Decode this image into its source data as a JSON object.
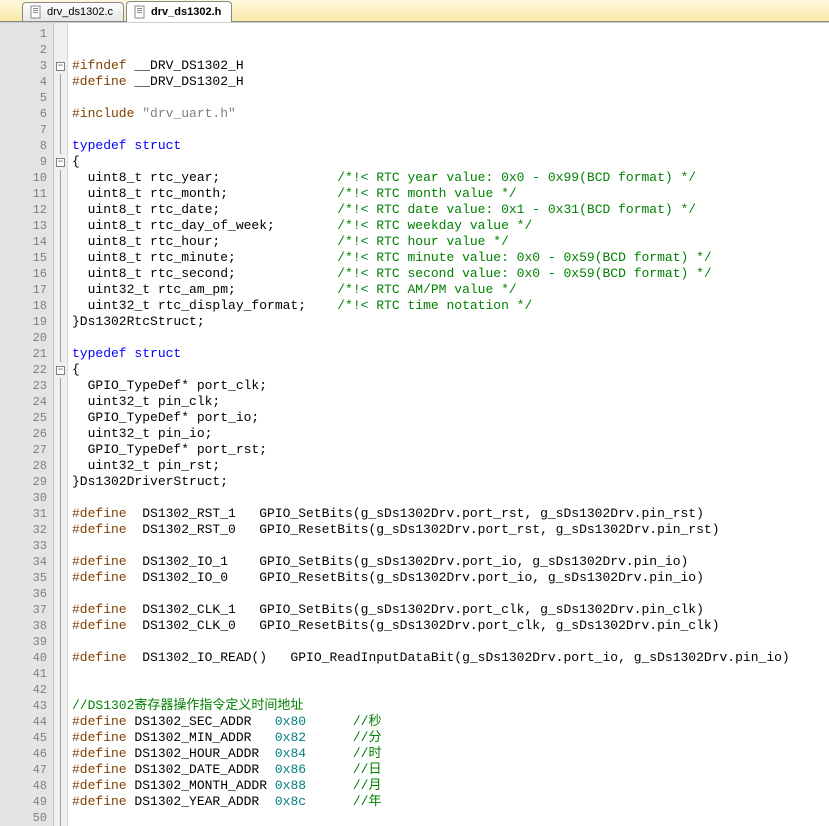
{
  "tabs": [
    {
      "label": "drv_ds1302.c",
      "active": false
    },
    {
      "label": "drv_ds1302.h",
      "active": true
    }
  ],
  "lines": [
    {
      "n": 1,
      "fold": "",
      "tokens": []
    },
    {
      "n": 2,
      "fold": "",
      "tokens": []
    },
    {
      "n": 3,
      "fold": "-",
      "tokens": [
        [
          "pp",
          "#ifndef"
        ],
        [
          "typ",
          " __DRV_DS1302_H"
        ]
      ]
    },
    {
      "n": 4,
      "fold": "|",
      "tokens": [
        [
          "pp",
          "#define"
        ],
        [
          "typ",
          " __DRV_DS1302_H"
        ]
      ]
    },
    {
      "n": 5,
      "fold": "|",
      "tokens": []
    },
    {
      "n": 6,
      "fold": "|",
      "tokens": [
        [
          "pp",
          "#include "
        ],
        [
          "str",
          "\"drv_uart.h\""
        ]
      ]
    },
    {
      "n": 7,
      "fold": "|",
      "tokens": []
    },
    {
      "n": 8,
      "fold": "|",
      "tokens": [
        [
          "kw",
          "typedef struct"
        ]
      ]
    },
    {
      "n": 9,
      "fold": "-",
      "tokens": [
        [
          "typ",
          "{"
        ]
      ]
    },
    {
      "n": 10,
      "fold": "|",
      "tokens": [
        [
          "typ",
          "  uint8_t rtc_year;               "
        ],
        [
          "cmt",
          "/*!< RTC year value: 0x0 - 0x99(BCD format) */"
        ]
      ]
    },
    {
      "n": 11,
      "fold": "|",
      "tokens": [
        [
          "typ",
          "  uint8_t rtc_month;              "
        ],
        [
          "cmt",
          "/*!< RTC month value */"
        ]
      ]
    },
    {
      "n": 12,
      "fold": "|",
      "tokens": [
        [
          "typ",
          "  uint8_t rtc_date;               "
        ],
        [
          "cmt",
          "/*!< RTC date value: 0x1 - 0x31(BCD format) */"
        ]
      ]
    },
    {
      "n": 13,
      "fold": "|",
      "tokens": [
        [
          "typ",
          "  uint8_t rtc_day_of_week;        "
        ],
        [
          "cmt",
          "/*!< RTC weekday value */"
        ]
      ]
    },
    {
      "n": 14,
      "fold": "|",
      "tokens": [
        [
          "typ",
          "  uint8_t rtc_hour;               "
        ],
        [
          "cmt",
          "/*!< RTC hour value */"
        ]
      ]
    },
    {
      "n": 15,
      "fold": "|",
      "tokens": [
        [
          "typ",
          "  uint8_t rtc_minute;             "
        ],
        [
          "cmt",
          "/*!< RTC minute value: 0x0 - 0x59(BCD format) */"
        ]
      ]
    },
    {
      "n": 16,
      "fold": "|",
      "tokens": [
        [
          "typ",
          "  uint8_t rtc_second;             "
        ],
        [
          "cmt",
          "/*!< RTC second value: 0x0 - 0x59(BCD format) */"
        ]
      ]
    },
    {
      "n": 17,
      "fold": "|",
      "tokens": [
        [
          "typ",
          "  uint32_t rtc_am_pm;             "
        ],
        [
          "cmt",
          "/*!< RTC AM/PM value */"
        ]
      ]
    },
    {
      "n": 18,
      "fold": "|",
      "tokens": [
        [
          "typ",
          "  uint32_t rtc_display_format;    "
        ],
        [
          "cmt",
          "/*!< RTC time notation */"
        ]
      ]
    },
    {
      "n": 19,
      "fold": "|",
      "tokens": [
        [
          "typ",
          "}Ds1302RtcStruct;"
        ]
      ]
    },
    {
      "n": 20,
      "fold": "|",
      "tokens": []
    },
    {
      "n": 21,
      "fold": "|",
      "tokens": [
        [
          "kw",
          "typedef struct"
        ]
      ]
    },
    {
      "n": 22,
      "fold": "-",
      "tokens": [
        [
          "typ",
          "{"
        ]
      ]
    },
    {
      "n": 23,
      "fold": "|",
      "tokens": [
        [
          "typ",
          "  GPIO_TypeDef* port_clk;"
        ]
      ]
    },
    {
      "n": 24,
      "fold": "|",
      "tokens": [
        [
          "typ",
          "  uint32_t pin_clk;"
        ]
      ]
    },
    {
      "n": 25,
      "fold": "|",
      "tokens": [
        [
          "typ",
          "  GPIO_TypeDef* port_io;"
        ]
      ]
    },
    {
      "n": 26,
      "fold": "|",
      "tokens": [
        [
          "typ",
          "  uint32_t pin_io;"
        ]
      ]
    },
    {
      "n": 27,
      "fold": "|",
      "tokens": [
        [
          "typ",
          "  GPIO_TypeDef* port_rst;"
        ]
      ]
    },
    {
      "n": 28,
      "fold": "|",
      "tokens": [
        [
          "typ",
          "  uint32_t pin_rst;"
        ]
      ]
    },
    {
      "n": 29,
      "fold": "|",
      "tokens": [
        [
          "typ",
          "}Ds1302DriverStruct;"
        ]
      ]
    },
    {
      "n": 30,
      "fold": "|",
      "tokens": []
    },
    {
      "n": 31,
      "fold": "|",
      "tokens": [
        [
          "pp",
          "#define"
        ],
        [
          "typ",
          "  DS1302_RST_1   GPIO_SetBits(g_sDs1302Drv.port_rst, g_sDs1302Drv.pin_rst)"
        ]
      ]
    },
    {
      "n": 32,
      "fold": "|",
      "tokens": [
        [
          "pp",
          "#define"
        ],
        [
          "typ",
          "  DS1302_RST_0   GPIO_ResetBits(g_sDs1302Drv.port_rst, g_sDs1302Drv.pin_rst)"
        ]
      ]
    },
    {
      "n": 33,
      "fold": "|",
      "tokens": []
    },
    {
      "n": 34,
      "fold": "|",
      "tokens": [
        [
          "pp",
          "#define"
        ],
        [
          "typ",
          "  DS1302_IO_1    GPIO_SetBits(g_sDs1302Drv.port_io, g_sDs1302Drv.pin_io)"
        ]
      ]
    },
    {
      "n": 35,
      "fold": "|",
      "tokens": [
        [
          "pp",
          "#define"
        ],
        [
          "typ",
          "  DS1302_IO_0    GPIO_ResetBits(g_sDs1302Drv.port_io, g_sDs1302Drv.pin_io)"
        ]
      ]
    },
    {
      "n": 36,
      "fold": "|",
      "tokens": []
    },
    {
      "n": 37,
      "fold": "|",
      "tokens": [
        [
          "pp",
          "#define"
        ],
        [
          "typ",
          "  DS1302_CLK_1   GPIO_SetBits(g_sDs1302Drv.port_clk, g_sDs1302Drv.pin_clk)"
        ]
      ]
    },
    {
      "n": 38,
      "fold": "|",
      "tokens": [
        [
          "pp",
          "#define"
        ],
        [
          "typ",
          "  DS1302_CLK_0   GPIO_ResetBits(g_sDs1302Drv.port_clk, g_sDs1302Drv.pin_clk)"
        ]
      ]
    },
    {
      "n": 39,
      "fold": "|",
      "tokens": []
    },
    {
      "n": 40,
      "fold": "|",
      "tokens": [
        [
          "pp",
          "#define"
        ],
        [
          "typ",
          "  DS1302_IO_READ()   GPIO_ReadInputDataBit(g_sDs1302Drv.port_io, g_sDs1302Drv.pin_io)"
        ]
      ]
    },
    {
      "n": 41,
      "fold": "|",
      "tokens": []
    },
    {
      "n": 42,
      "fold": "|",
      "tokens": []
    },
    {
      "n": 43,
      "fold": "|",
      "tokens": [
        [
          "cmt",
          "//DS1302寄存器操作指令定义时间地址"
        ]
      ]
    },
    {
      "n": 44,
      "fold": "|",
      "tokens": [
        [
          "pp",
          "#define"
        ],
        [
          "typ",
          " DS1302_SEC_ADDR   "
        ],
        [
          "num",
          "0x80"
        ],
        [
          "typ",
          "      "
        ],
        [
          "cmt",
          "//秒"
        ]
      ]
    },
    {
      "n": 45,
      "fold": "|",
      "tokens": [
        [
          "pp",
          "#define"
        ],
        [
          "typ",
          " DS1302_MIN_ADDR   "
        ],
        [
          "num",
          "0x82"
        ],
        [
          "typ",
          "      "
        ],
        [
          "cmt",
          "//分"
        ]
      ]
    },
    {
      "n": 46,
      "fold": "|",
      "tokens": [
        [
          "pp",
          "#define"
        ],
        [
          "typ",
          " DS1302_HOUR_ADDR  "
        ],
        [
          "num",
          "0x84"
        ],
        [
          "typ",
          "      "
        ],
        [
          "cmt",
          "//时"
        ]
      ]
    },
    {
      "n": 47,
      "fold": "|",
      "tokens": [
        [
          "pp",
          "#define"
        ],
        [
          "typ",
          " DS1302_DATE_ADDR  "
        ],
        [
          "num",
          "0x86"
        ],
        [
          "typ",
          "      "
        ],
        [
          "cmt",
          "//日"
        ]
      ]
    },
    {
      "n": 48,
      "fold": "|",
      "tokens": [
        [
          "pp",
          "#define"
        ],
        [
          "typ",
          " DS1302_MONTH_ADDR "
        ],
        [
          "num",
          "0x88"
        ],
        [
          "typ",
          "      "
        ],
        [
          "cmt",
          "//月"
        ]
      ]
    },
    {
      "n": 49,
      "fold": "|",
      "tokens": [
        [
          "pp",
          "#define"
        ],
        [
          "typ",
          " DS1302_YEAR_ADDR  "
        ],
        [
          "num",
          "0x8c"
        ],
        [
          "typ",
          "      "
        ],
        [
          "cmt",
          "//年"
        ]
      ]
    },
    {
      "n": 50,
      "fold": "|",
      "tokens": []
    }
  ]
}
